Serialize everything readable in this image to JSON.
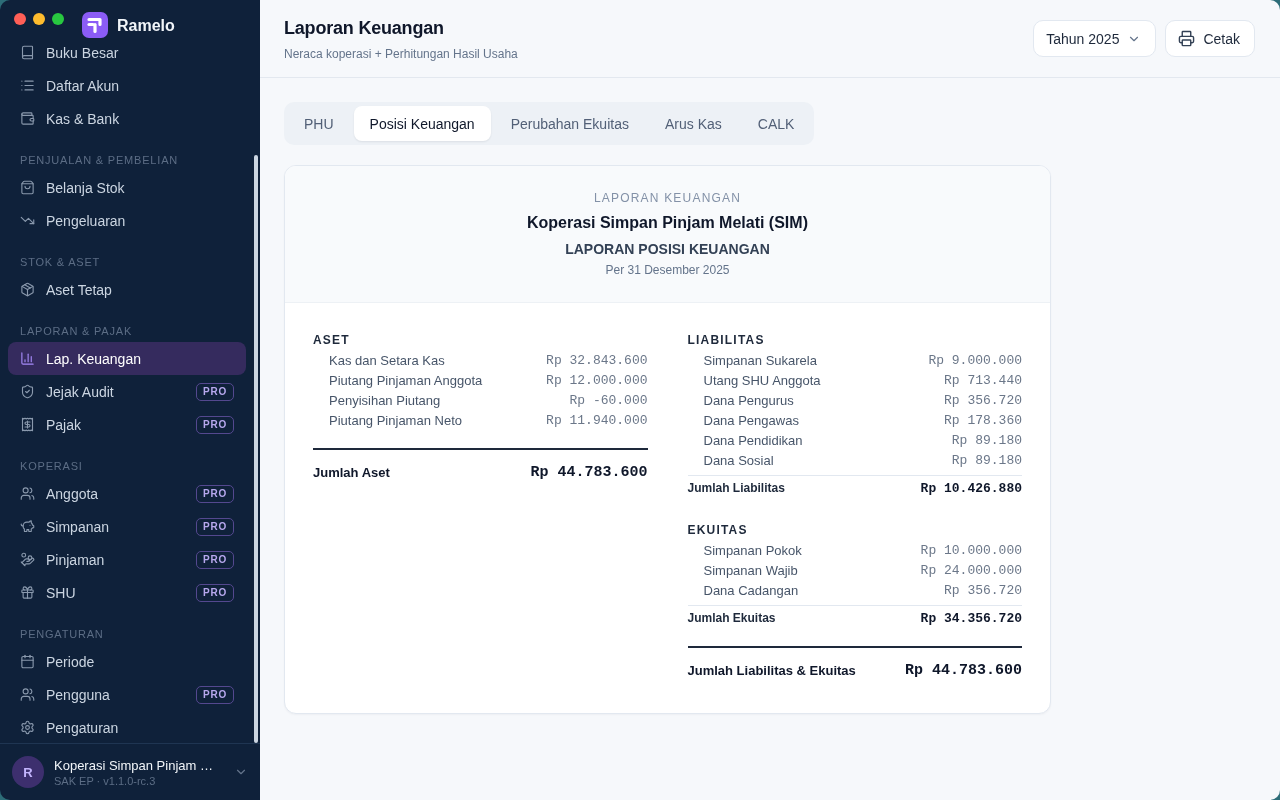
{
  "window": {
    "app_name": "Ramelo"
  },
  "sidebar": {
    "sections": [
      {
        "items": [
          {
            "label": "Buku Besar",
            "selected": false
          },
          {
            "label": "Daftar Akun",
            "selected": false
          },
          {
            "label": "Kas & Bank",
            "selected": false
          }
        ]
      },
      {
        "heading": "PENJUALAN & PEMBELIAN",
        "items": [
          {
            "label": "Belanja Stok",
            "selected": false
          },
          {
            "label": "Pengeluaran",
            "selected": false
          }
        ]
      },
      {
        "heading": "STOK & ASET",
        "items": [
          {
            "label": "Aset Tetap",
            "selected": false
          }
        ]
      },
      {
        "heading": "LAPORAN & PAJAK",
        "items": [
          {
            "label": "Lap. Keuangan",
            "selected": true
          },
          {
            "label": "Jejak Audit",
            "badge": "PRO",
            "selected": false
          },
          {
            "label": "Pajak",
            "badge": "PRO",
            "selected": false
          }
        ]
      },
      {
        "heading": "KOPERASI",
        "items": [
          {
            "label": "Anggota",
            "badge": "PRO",
            "selected": false
          },
          {
            "label": "Simpanan",
            "badge": "PRO",
            "selected": false
          },
          {
            "label": "Pinjaman",
            "badge": "PRO",
            "selected": false
          },
          {
            "label": "SHU",
            "badge": "PRO",
            "selected": false
          }
        ]
      },
      {
        "heading": "PENGATURAN",
        "items": [
          {
            "label": "Periode",
            "selected": false
          },
          {
            "label": "Pengguna",
            "badge": "PRO",
            "selected": false
          },
          {
            "label": "Pengaturan",
            "selected": false
          }
        ]
      }
    ],
    "account": {
      "avatar": "R",
      "name": "Koperasi Simpan Pinjam …",
      "subtitle": "SAK EP · v1.1.0-rc.3"
    }
  },
  "header": {
    "title": "Laporan Keuangan",
    "subtitle": "Neraca koperasi + Perhitungan Hasil Usaha",
    "year_select": {
      "value": "Tahun 2025"
    },
    "print_button": "Cetak"
  },
  "tabs": [
    {
      "label": "PHU",
      "selected": false
    },
    {
      "label": "Posisi Keuangan",
      "selected": true
    },
    {
      "label": "Perubahan Ekuitas",
      "selected": false
    },
    {
      "label": "Arus Kas",
      "selected": false
    },
    {
      "label": "CALK",
      "selected": false
    }
  ],
  "report": {
    "kicker": "LAPORAN KEUANGAN",
    "organization": "Koperasi Simpan Pinjam Melati (SIM)",
    "title": "LAPORAN POSISI KEUANGAN",
    "date": "Per 31 Desember 2025",
    "columns": [
      {
        "sections": [
          {
            "heading": "ASET",
            "rows": [
              {
                "label": "Kas dan Setara Kas",
                "value": "Rp 32.843.600"
              },
              {
                "label": "Piutang Pinjaman Anggota",
                "value": "Rp 12.000.000"
              },
              {
                "label": "Penyisihan Piutang",
                "value": "Rp -60.000"
              },
              {
                "label": "Piutang Pinjaman Neto",
                "value": "Rp 11.940.000"
              }
            ]
          }
        ],
        "grand_total": {
          "label": "Jumlah Aset",
          "value": "Rp 44.783.600"
        }
      },
      {
        "sections": [
          {
            "heading": "LIABILITAS",
            "rows": [
              {
                "label": "Simpanan Sukarela",
                "value": "Rp 9.000.000"
              },
              {
                "label": "Utang SHU Anggota",
                "value": "Rp 713.440"
              },
              {
                "label": "Dana Pengurus",
                "value": "Rp 356.720"
              },
              {
                "label": "Dana Pengawas",
                "value": "Rp 178.360"
              },
              {
                "label": "Dana Pendidikan",
                "value": "Rp 89.180"
              },
              {
                "label": "Dana Sosial",
                "value": "Rp 89.180"
              }
            ],
            "subtotal": {
              "label": "Jumlah Liabilitas",
              "value": "Rp 10.426.880"
            }
          },
          {
            "heading": "EKUITAS",
            "rows": [
              {
                "label": "Simpanan Pokok",
                "value": "Rp 10.000.000"
              },
              {
                "label": "Simpanan Wajib",
                "value": "Rp 24.000.000"
              },
              {
                "label": "Dana Cadangan",
                "value": "Rp 356.720"
              }
            ],
            "subtotal": {
              "label": "Jumlah Ekuitas",
              "value": "Rp 34.356.720"
            }
          }
        ],
        "grand_total": {
          "label": "Jumlah Liabilitas & Ekuitas",
          "value": "Rp 44.783.600"
        }
      }
    ]
  }
}
